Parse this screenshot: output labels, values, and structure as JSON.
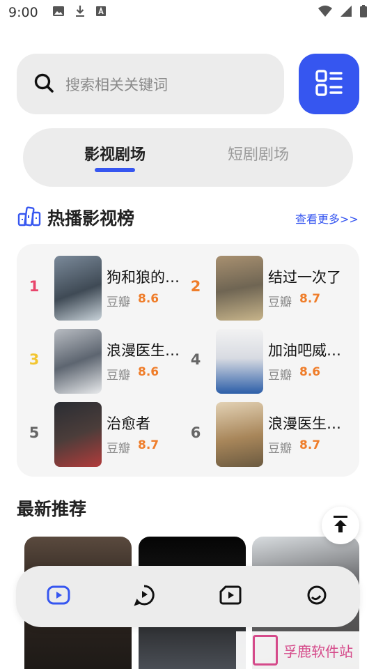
{
  "status_bar": {
    "time": "9:00",
    "left_icons": [
      "image-icon",
      "download-icon",
      "font-icon"
    ],
    "right_icons": [
      "wifi-icon",
      "signal-icon",
      "battery-icon"
    ]
  },
  "search": {
    "placeholder": "搜索相关关键词"
  },
  "tabs": [
    {
      "label": "影视剧场",
      "active": true
    },
    {
      "label": "短剧剧场",
      "active": false
    }
  ],
  "hot_section": {
    "title": "热播影视榜",
    "more_link": "查看更多>>"
  },
  "ranking": [
    {
      "rank": "1",
      "title": "狗和狼的…",
      "source": "豆瓣",
      "score": "8.6",
      "rank_color": "#e8456b"
    },
    {
      "rank": "2",
      "title": "结过一次了",
      "source": "豆瓣",
      "score": "8.7",
      "rank_color": "#ef7d2a"
    },
    {
      "rank": "3",
      "title": "浪漫医生…",
      "source": "豆瓣",
      "score": "8.6",
      "rank_color": "#f2c530"
    },
    {
      "rank": "4",
      "title": "加油吧威…",
      "source": "豆瓣",
      "score": "8.6",
      "rank_color": "#666666"
    },
    {
      "rank": "5",
      "title": "治愈者",
      "source": "豆瓣",
      "score": "8.7",
      "rank_color": "#666666"
    },
    {
      "rank": "6",
      "title": "浪漫医生…",
      "source": "豆瓣",
      "score": "8.7",
      "rank_color": "#666666"
    }
  ],
  "latest_section": {
    "title": "最新推荐"
  },
  "bottom_nav": [
    {
      "name": "video",
      "active": true
    },
    {
      "name": "chat",
      "active": false
    },
    {
      "name": "short-video",
      "active": false
    },
    {
      "name": "profile",
      "active": false
    }
  ],
  "watermark": {
    "text": "孚鹿软件站"
  },
  "colors": {
    "accent": "#3656f0",
    "score": "#ef7d2a",
    "surface": "#ececec"
  }
}
